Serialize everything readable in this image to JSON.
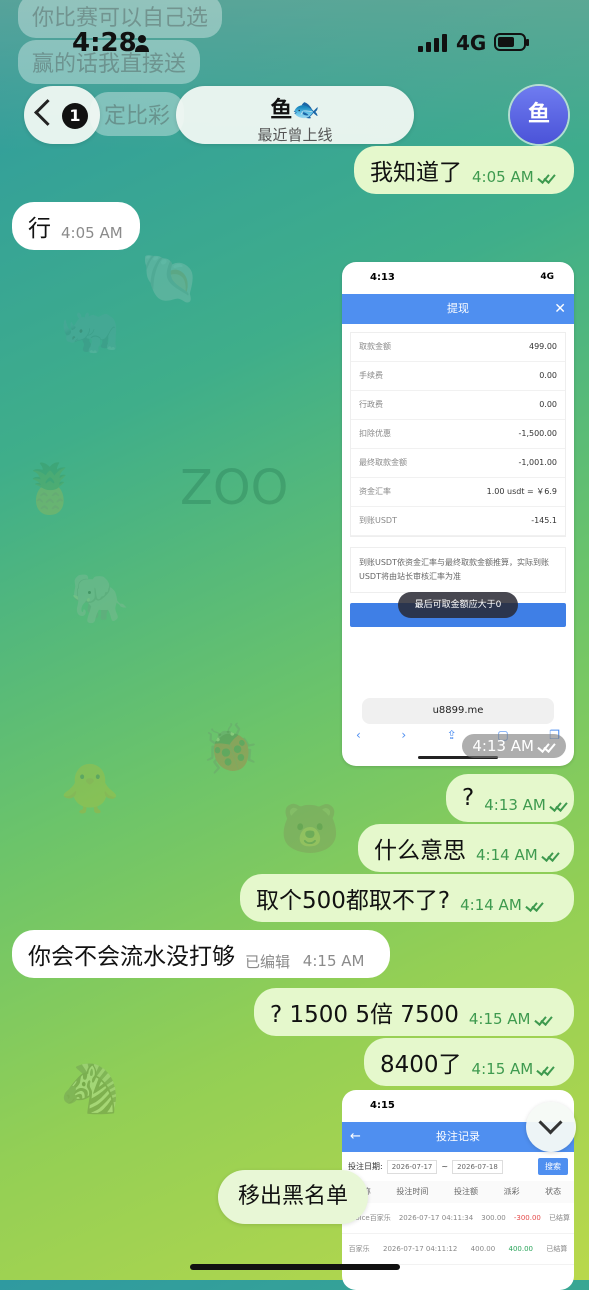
{
  "status_bar": {
    "time": "4:28",
    "network": "4G"
  },
  "ghost_messages": [
    "你比赛可以自己选",
    "赢的话我直接送",
    "定比彩"
  ],
  "header": {
    "back_count": "1",
    "contact_name": "鱼",
    "contact_emoji": "🐟",
    "contact_status": "最近曾上线",
    "avatar_letter": "鱼"
  },
  "messages": [
    {
      "dir": "out",
      "text": "我知道了",
      "time": "4:05 AM"
    },
    {
      "dir": "in",
      "text": "行",
      "time": "4:05 AM"
    },
    {
      "dir": "out",
      "text": "?",
      "time": "4:13 AM"
    },
    {
      "dir": "out",
      "text": "什么意思",
      "time": "4:14 AM"
    },
    {
      "dir": "out",
      "text": "取个500都取不了?",
      "time": "4:14 AM"
    },
    {
      "dir": "in",
      "text": "你会不会流水没打够",
      "edited": "已编辑",
      "time": "4:15 AM"
    },
    {
      "dir": "out",
      "text": "? 1500 5倍 7500",
      "time": "4:15 AM"
    },
    {
      "dir": "out",
      "text": "8400了",
      "time": "4:15 AM"
    }
  ],
  "screenshot1": {
    "time": "4:13",
    "net": "4G",
    "title": "提现",
    "rows": [
      {
        "label": "取款金额",
        "value": "499.00"
      },
      {
        "label": "手续费",
        "value": "0.00"
      },
      {
        "label": "行政费",
        "value": "0.00"
      },
      {
        "label": "扣除优惠",
        "value": "-1,500.00"
      },
      {
        "label": "最终取款金额",
        "value": "-1,001.00"
      },
      {
        "label": "资金汇率",
        "value": "1.00 usdt = ￥6.9"
      },
      {
        "label": "到账USDT",
        "value": "-145.1"
      }
    ],
    "note": "到账USDT依资金汇率与最终取款金额推算，实际到账USDT将由站长审核汇率为准",
    "toast": "最后可取金额应大于0",
    "url": "u8899.me",
    "msg_time": "4:13 AM"
  },
  "screenshot2": {
    "time": "4:15",
    "title": "投注记录",
    "date_label": "投注日期:",
    "date_from": "2026-07-17",
    "date_sep": "~",
    "date_to": "2026-07-18",
    "search": "搜索",
    "headers": [
      "名称",
      "投注时间",
      "投注额",
      "派彩",
      "状态"
    ],
    "rows": [
      {
        "name": "Choice百家乐",
        "time": "2026-07-17 04:11:34",
        "amount": "300.00",
        "payout": "-300.00",
        "status": "已结算"
      },
      {
        "name": "百家乐",
        "time": "2026-07-17 04:11:12",
        "amount": "400.00",
        "payout": "400.00",
        "status": "已结算"
      }
    ]
  },
  "unblock_label": "移出黑名单"
}
